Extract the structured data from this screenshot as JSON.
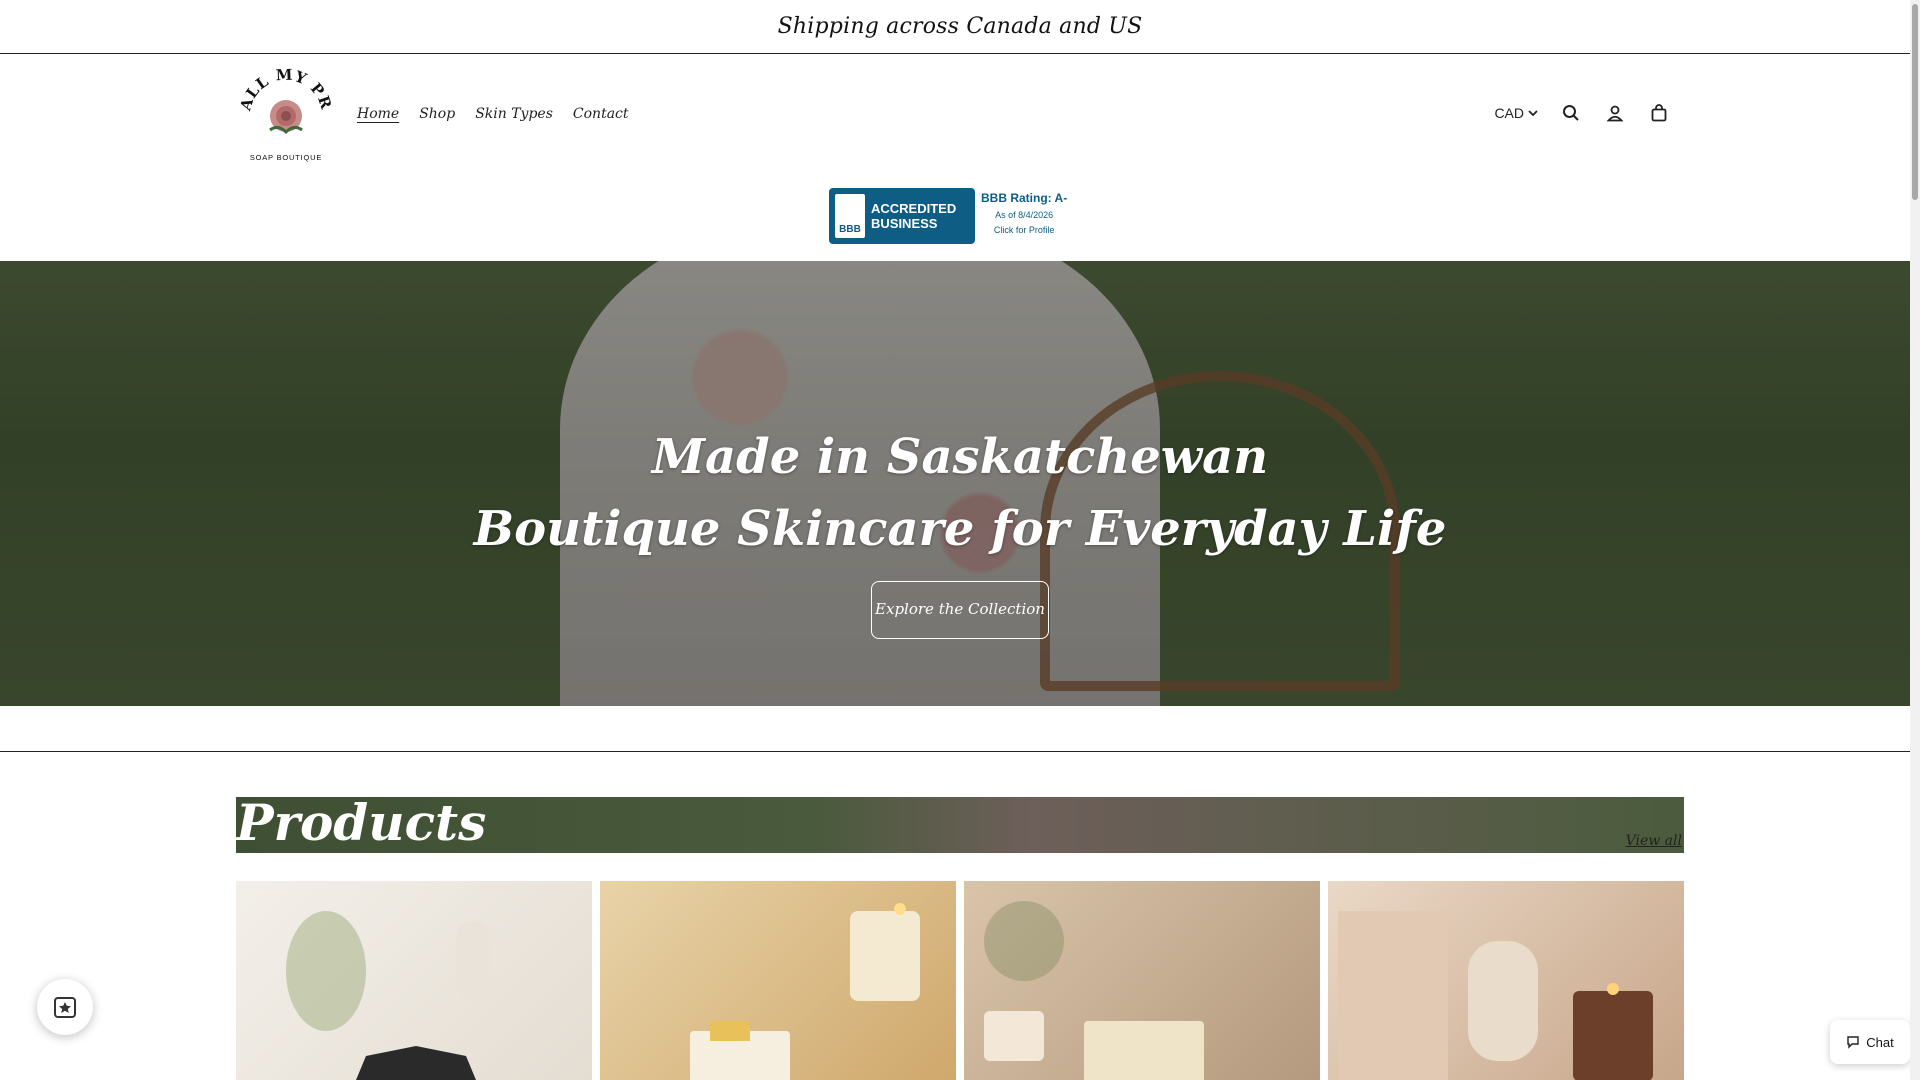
{
  "announcement": {
    "text": "Shipping across Canada and US"
  },
  "header": {
    "logo": {
      "top_text": "ALL MY PRETTIES",
      "bottom_text": "SOAP BOUTIQUE"
    },
    "nav": [
      {
        "label": "Home",
        "active": true
      },
      {
        "label": "Shop"
      },
      {
        "label": "Skin Types"
      },
      {
        "label": "Contact"
      }
    ],
    "currency": "CAD",
    "icons": [
      "search-icon",
      "account-icon",
      "cart-icon"
    ]
  },
  "bbb": {
    "seal": "BBB",
    "badge_line1": "ACCREDITED",
    "badge_line2": "BUSINESS",
    "rating": "BBB Rating: A-",
    "as_of": "As of 8/4/2026",
    "click": "Click for Profile"
  },
  "hero": {
    "line1": "Made in Saskatchewan",
    "line2": "Boutique Skincare for Everyday Life",
    "button": "Explore the Collection"
  },
  "products": {
    "title": "Products",
    "view_all": "View all"
  },
  "chat": {
    "label": "Chat"
  },
  "colors": {
    "bbb_blue": "#0d5d85",
    "text": "#121212"
  }
}
